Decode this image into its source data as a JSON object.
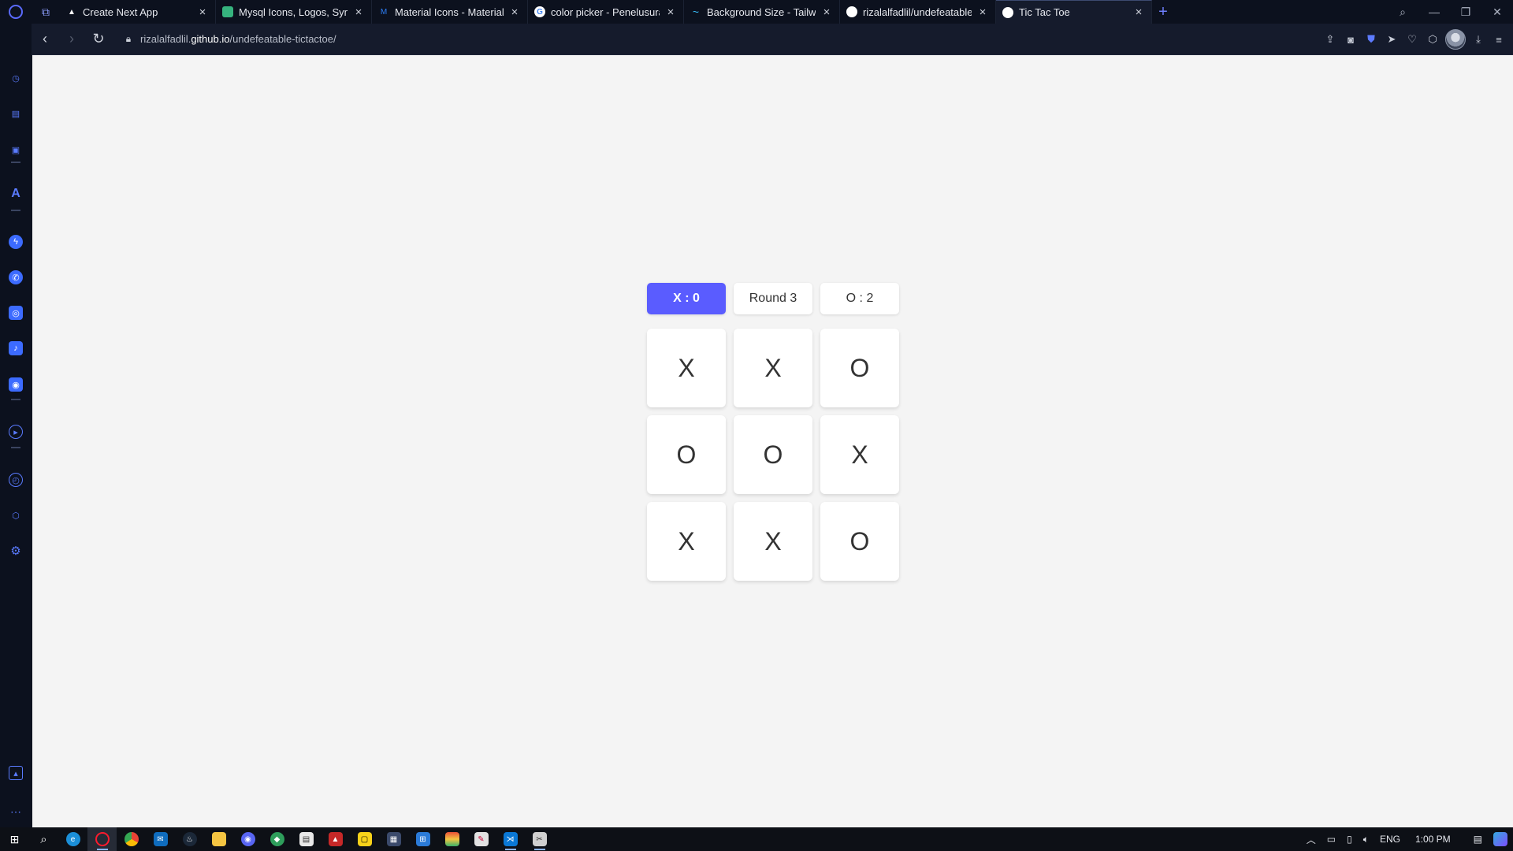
{
  "tabs": [
    {
      "title": "Create Next App",
      "fav_color": "#0c111e",
      "fav_glyph": "▲",
      "active": false
    },
    {
      "title": "Mysql Icons, Logos, Symbo",
      "fav_color": "#36b37e",
      "fav_glyph": "",
      "active": false
    },
    {
      "title": "Material Icons - Material UI",
      "fav_color": "#2d7ff9",
      "fav_glyph": "M",
      "active": false
    },
    {
      "title": "color picker - Penelusuran",
      "fav_color": "#ffffff",
      "fav_glyph": "G",
      "active": false
    },
    {
      "title": "Background Size - Tailwind",
      "fav_color": "#38bdf8",
      "fav_glyph": "~",
      "active": false
    },
    {
      "title": "rizalalfadlil/undefeatable-ti",
      "fav_color": "#ffffff",
      "fav_glyph": "",
      "active": false
    },
    {
      "title": "Tic Tac Toe",
      "fav_color": "#ffffff",
      "fav_glyph": "",
      "active": true
    }
  ],
  "address": {
    "prefix": "rizalalfadlil.",
    "domain": "github.io",
    "path": "/undefeatable-tictactoe/"
  },
  "game": {
    "x_score": "X : 0",
    "round": "Round 3",
    "o_score": "O : 2",
    "board": [
      "X",
      "X",
      "O",
      "O",
      "O",
      "X",
      "X",
      "X",
      "O"
    ]
  },
  "tray": {
    "language": "ENG",
    "time": "1:00 PM"
  },
  "colors": {
    "accent": "#5a5cff",
    "page_bg": "#f4f4f4",
    "browser_bg": "#0c111e"
  }
}
